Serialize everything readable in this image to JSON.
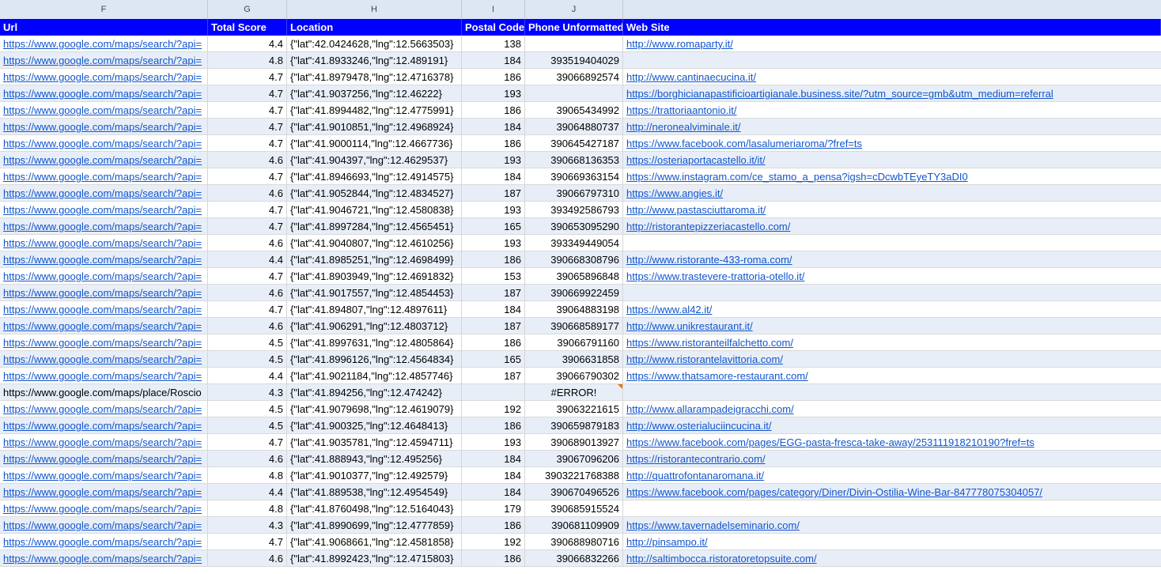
{
  "columns": [
    "F",
    "G",
    "H",
    "I",
    "J",
    ""
  ],
  "headers": {
    "url": "Url",
    "score": "Total Score",
    "location": "Location",
    "postal": "Postal Code",
    "phone": "Phone Unformatted",
    "website": "Web Site"
  },
  "rows": [
    {
      "url": "https://www.google.com/maps/search/?api=",
      "score": "4.4",
      "location": "{\"lat\":42.0424628,\"lng\":12.5663503}",
      "postal": "138",
      "phone": "",
      "website": "http://www.romaparty.it/"
    },
    {
      "url": "https://www.google.com/maps/search/?api=",
      "score": "4.8",
      "location": "{\"lat\":41.8933246,\"lng\":12.489191}",
      "postal": "184",
      "phone": "393519404029",
      "website": ""
    },
    {
      "url": "https://www.google.com/maps/search/?api=",
      "score": "4.7",
      "location": "{\"lat\":41.8979478,\"lng\":12.4716378}",
      "postal": "186",
      "phone": "39066892574",
      "website": "http://www.cantinaecucina.it/"
    },
    {
      "url": "https://www.google.com/maps/search/?api=",
      "score": "4.7",
      "location": "{\"lat\":41.9037256,\"lng\":12.46222}",
      "postal": "193",
      "phone": "",
      "website": "https://borghicianapastificioartigianale.business.site/?utm_source=gmb&utm_medium=referral"
    },
    {
      "url": "https://www.google.com/maps/search/?api=",
      "score": "4.7",
      "location": "{\"lat\":41.8994482,\"lng\":12.4775991}",
      "postal": "186",
      "phone": "39065434992",
      "website": "https://trattoriaantonio.it/"
    },
    {
      "url": "https://www.google.com/maps/search/?api=",
      "score": "4.7",
      "location": "{\"lat\":41.9010851,\"lng\":12.4968924}",
      "postal": "184",
      "phone": "39064880737",
      "website": "http://neronealviminale.it/"
    },
    {
      "url": "https://www.google.com/maps/search/?api=",
      "score": "4.7",
      "location": "{\"lat\":41.9000114,\"lng\":12.4667736}",
      "postal": "186",
      "phone": "390645427187",
      "website": "https://www.facebook.com/lasalumeriaroma/?fref=ts"
    },
    {
      "url": "https://www.google.com/maps/search/?api=",
      "score": "4.6",
      "location": "{\"lat\":41.904397,\"lng\":12.4629537}",
      "postal": "193",
      "phone": "390668136353",
      "website": "https://osteriaportacastello.it/it/"
    },
    {
      "url": "https://www.google.com/maps/search/?api=",
      "score": "4.7",
      "location": "{\"lat\":41.8946693,\"lng\":12.4914575}",
      "postal": "184",
      "phone": "390669363154",
      "website": "https://www.instagram.com/ce_stamo_a_pensa?igsh=cDcwbTEyeTY3aDI0"
    },
    {
      "url": "https://www.google.com/maps/search/?api=",
      "score": "4.6",
      "location": "{\"lat\":41.9052844,\"lng\":12.4834527}",
      "postal": "187",
      "phone": "39066797310",
      "website": "https://www.angies.it/"
    },
    {
      "url": "https://www.google.com/maps/search/?api=",
      "score": "4.7",
      "location": "{\"lat\":41.9046721,\"lng\":12.4580838}",
      "postal": "193",
      "phone": "393492586793",
      "website": "http://www.pastasciuttaroma.it/"
    },
    {
      "url": "https://www.google.com/maps/search/?api=",
      "score": "4.7",
      "location": "{\"lat\":41.8997284,\"lng\":12.4565451}",
      "postal": "165",
      "phone": "390653095290",
      "website": "http://ristorantepizzeriacastello.com/"
    },
    {
      "url": "https://www.google.com/maps/search/?api=",
      "score": "4.6",
      "location": "{\"lat\":41.9040807,\"lng\":12.4610256}",
      "postal": "193",
      "phone": "393349449054",
      "website": ""
    },
    {
      "url": "https://www.google.com/maps/search/?api=",
      "score": "4.4",
      "location": "{\"lat\":41.8985251,\"lng\":12.4698499}",
      "postal": "186",
      "phone": "390668308796",
      "website": "http://www.ristorante-433-roma.com/"
    },
    {
      "url": "https://www.google.com/maps/search/?api=",
      "score": "4.7",
      "location": "{\"lat\":41.8903949,\"lng\":12.4691832}",
      "postal": "153",
      "phone": "39065896848",
      "website": "https://www.trastevere-trattoria-otello.it/"
    },
    {
      "url": "https://www.google.com/maps/search/?api=",
      "score": "4.6",
      "location": "{\"lat\":41.9017557,\"lng\":12.4854453}",
      "postal": "187",
      "phone": "390669922459",
      "website": ""
    },
    {
      "url": "https://www.google.com/maps/search/?api=",
      "score": "4.7",
      "location": "{\"lat\":41.894807,\"lng\":12.4897611}",
      "postal": "184",
      "phone": "39064883198",
      "website": "https://www.al42.it/"
    },
    {
      "url": "https://www.google.com/maps/search/?api=",
      "score": "4.6",
      "location": "{\"lat\":41.906291,\"lng\":12.4803712}",
      "postal": "187",
      "phone": "390668589177",
      "website": "http://www.unikrestaurant.it/"
    },
    {
      "url": "https://www.google.com/maps/search/?api=",
      "score": "4.5",
      "location": "{\"lat\":41.8997631,\"lng\":12.4805864}",
      "postal": "186",
      "phone": "39066791160",
      "website": "https://www.ristoranteilfalchetto.com/"
    },
    {
      "url": "https://www.google.com/maps/search/?api=",
      "score": "4.5",
      "location": "{\"lat\":41.8996126,\"lng\":12.4564834}",
      "postal": "165",
      "phone": "3906631858",
      "website": "http://www.ristorantelavittoria.com/"
    },
    {
      "url": "https://www.google.com/maps/search/?api=",
      "score": "4.4",
      "location": "{\"lat\":41.9021184,\"lng\":12.4857746}",
      "postal": "187",
      "phone": "39066790302",
      "website": "https://www.thatsamore-restaurant.com/"
    },
    {
      "url": "https://www.google.com/maps/place/Roscio",
      "score": "4.3",
      "location": "{\"lat\":41.894256,\"lng\":12.474242}",
      "postal": "",
      "phone": "#ERROR!",
      "website": "",
      "error": true
    },
    {
      "url": "https://www.google.com/maps/search/?api=",
      "score": "4.5",
      "location": "{\"lat\":41.9079698,\"lng\":12.4619079}",
      "postal": "192",
      "phone": "39063221615",
      "website": "http://www.allarampadeigracchi.com/"
    },
    {
      "url": "https://www.google.com/maps/search/?api=",
      "score": "4.5",
      "location": "{\"lat\":41.900325,\"lng\":12.4648413}",
      "postal": "186",
      "phone": "390659879183",
      "website": "http://www.osterialuciincucina.it/"
    },
    {
      "url": "https://www.google.com/maps/search/?api=",
      "score": "4.7",
      "location": "{\"lat\":41.9035781,\"lng\":12.4594711}",
      "postal": "193",
      "phone": "390689013927",
      "website": "https://www.facebook.com/pages/EGG-pasta-fresca-take-away/253111918210190?fref=ts"
    },
    {
      "url": "https://www.google.com/maps/search/?api=",
      "score": "4.6",
      "location": "{\"lat\":41.888943,\"lng\":12.495256}",
      "postal": "184",
      "phone": "39067096206",
      "website": "https://ristorantecontrario.com/"
    },
    {
      "url": "https://www.google.com/maps/search/?api=",
      "score": "4.8",
      "location": "{\"lat\":41.9010377,\"lng\":12.492579}",
      "postal": "184",
      "phone": "3903221768388",
      "website": "http://quattrofontanaromana.it/"
    },
    {
      "url": "https://www.google.com/maps/search/?api=",
      "score": "4.4",
      "location": "{\"lat\":41.889538,\"lng\":12.4954549}",
      "postal": "184",
      "phone": "390670496526",
      "website": "https://www.facebook.com/pages/category/Diner/Divin-Ostilia-Wine-Bar-847778075304057/"
    },
    {
      "url": "https://www.google.com/maps/search/?api=",
      "score": "4.8",
      "location": "{\"lat\":41.8760498,\"lng\":12.5164043}",
      "postal": "179",
      "phone": "390685915524",
      "website": ""
    },
    {
      "url": "https://www.google.com/maps/search/?api=",
      "score": "4.3",
      "location": "{\"lat\":41.8990699,\"lng\":12.4777859}",
      "postal": "186",
      "phone": "390681109909",
      "website": "https://www.tavernadelseminario.com/"
    },
    {
      "url": "https://www.google.com/maps/search/?api=",
      "score": "4.7",
      "location": "{\"lat\":41.9068661,\"lng\":12.4581858}",
      "postal": "192",
      "phone": "390688980716",
      "website": "http://pinsampo.it/"
    },
    {
      "url": "https://www.google.com/maps/search/?api=",
      "score": "4.6",
      "location": "{\"lat\":41.8992423,\"lng\":12.4715803}",
      "postal": "186",
      "phone": "39066832266",
      "website": "http://saltimbocca.ristoratoretopsuite.com/"
    }
  ]
}
